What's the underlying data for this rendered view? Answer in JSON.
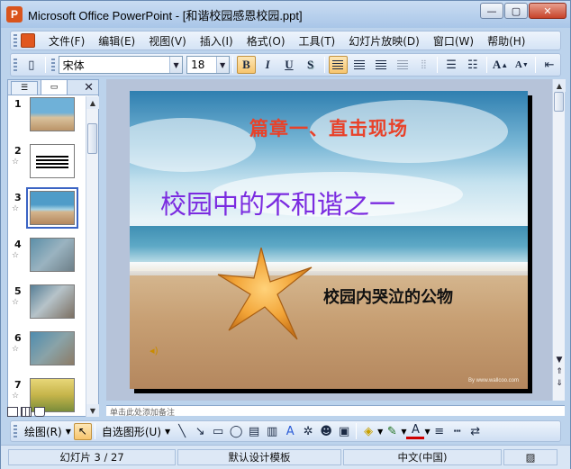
{
  "window": {
    "title": "Microsoft Office PowerPoint - [和谐校园感恩校园.ppt]",
    "controls": {
      "minimize": "—",
      "maximize": "▢",
      "close": "✕"
    }
  },
  "menu": {
    "items": [
      "文件(F)",
      "编辑(E)",
      "视图(V)",
      "插入(I)",
      "格式(O)",
      "工具(T)",
      "幻灯片放映(D)",
      "窗口(W)",
      "帮助(H)"
    ]
  },
  "toolbar": {
    "font_name": "宋体",
    "font_size": "18",
    "bold": "B",
    "italic": "I",
    "underline": "U",
    "shadow": "S",
    "grow_font": "A",
    "shrink_font": "A"
  },
  "slides_pane": {
    "slides": [
      {
        "number": "1",
        "star": ""
      },
      {
        "number": "2",
        "star": "☆"
      },
      {
        "number": "3",
        "star": "☆"
      },
      {
        "number": "4",
        "star": "☆"
      },
      {
        "number": "5",
        "star": "☆"
      },
      {
        "number": "6",
        "star": "☆"
      },
      {
        "number": "7",
        "star": "☆"
      }
    ],
    "selected_index": 2
  },
  "slide": {
    "title": "篇章一、直击现场",
    "heading": "校园中的不和谐之一",
    "subtitle": "校园内哭泣的公物",
    "watermark": "By www.wallcoo.com"
  },
  "notes": {
    "text": "单击此处添加备注"
  },
  "drawing_toolbar": {
    "draw_label": "绘图(R)",
    "autoshapes_label": "自选图形(U)"
  },
  "status": {
    "slide_indicator": "幻灯片 3 / 27",
    "design_template": "默认设计模板",
    "language": "中文(中国)"
  },
  "colors": {
    "slide_title": "#e8422a",
    "slide_heading": "#7b2be0",
    "selected_thumb_outline": "#3b64c4"
  }
}
